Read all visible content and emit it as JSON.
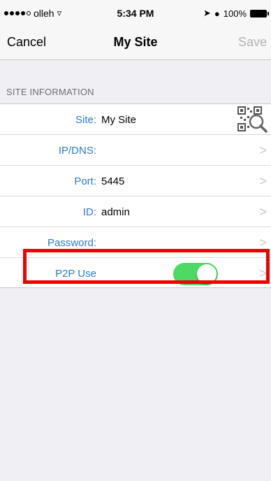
{
  "status_bar": {
    "carrier": "olleh",
    "time": "5:34 PM",
    "battery": "100%"
  },
  "nav": {
    "cancel": "Cancel",
    "title": "My Site",
    "save": "Save"
  },
  "section_header": "SITE INFORMATION",
  "rows": [
    {
      "label": "Site:",
      "value": "My Site"
    },
    {
      "label": "IP/DNS:",
      "value": ""
    },
    {
      "label": "Port:",
      "value": "5445"
    },
    {
      "label": "ID:",
      "value": "admin"
    },
    {
      "label": "Password:",
      "value": ""
    },
    {
      "label": "P2P Use",
      "value": ""
    }
  ],
  "p2p_toggle_on": true,
  "colors": {
    "label_blue": "#2a7bd0",
    "toggle_green": "#4cd964",
    "highlight_red": "#ee0000"
  }
}
